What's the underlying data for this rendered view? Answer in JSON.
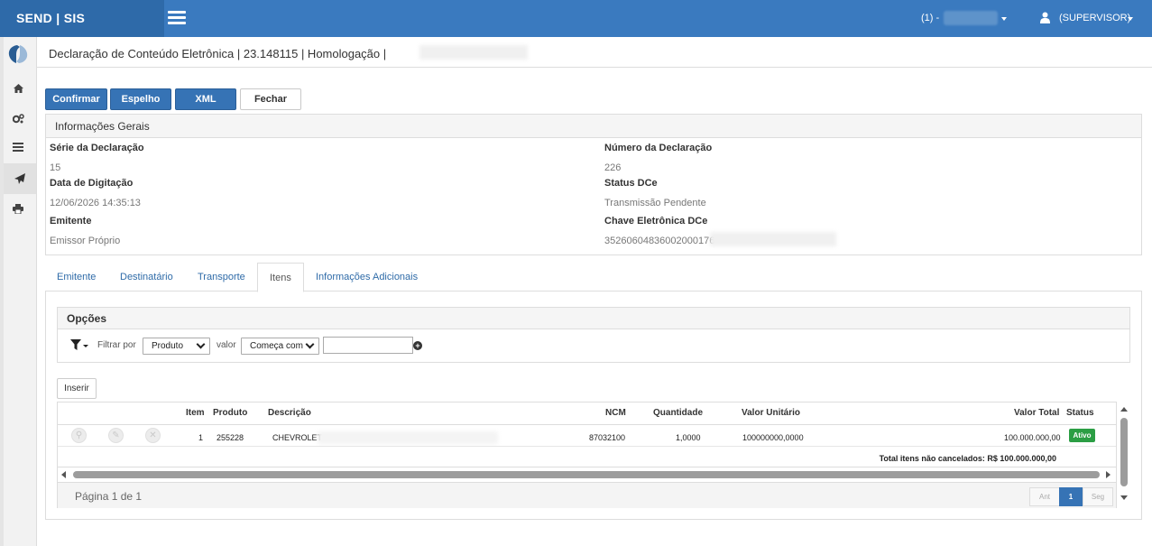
{
  "header": {
    "brand": "SEND | SIS",
    "company_label": "(1) -",
    "user_label": "(SUPERVISOR)"
  },
  "page": {
    "title": "Declaração de Conteúdo Eletrônica | 23.148115 | Homologação |"
  },
  "toolbar": {
    "confirm": "Confirmar",
    "mirror": "Espelho",
    "xml": "XML",
    "close": "Fechar"
  },
  "info": {
    "heading": "Informações Gerais",
    "serie_label": "Série da Declaração",
    "serie_value": "15",
    "numero_label": "Número da Declaração",
    "numero_value": "226",
    "data_label": "Data de Digitação",
    "data_value": "12/06/2026 14:35:13",
    "status_label": "Status DCe",
    "status_value": "Transmissão Pendente",
    "emitente_label": "Emitente",
    "emitente_value": "Emissor Próprio",
    "chave_label": "Chave Eletrônica DCe",
    "chave_value": "35260604836002000176"
  },
  "tabs": [
    {
      "label": "Emitente"
    },
    {
      "label": "Destinatário"
    },
    {
      "label": "Transporte"
    },
    {
      "label": "Itens"
    },
    {
      "label": "Informações Adicionais"
    }
  ],
  "options": {
    "heading": "Opções",
    "filter_by_label": "Filtrar por",
    "filter_by_value": "Produto",
    "value_label": "valor",
    "value_mode": "Começa com",
    "search_value": ""
  },
  "grid": {
    "insert_label": "Inserir",
    "columns": {
      "item": "Item",
      "produto": "Produto",
      "descricao": "Descrição",
      "ncm": "NCM",
      "quantidade": "Quantidade",
      "valor_unitario": "Valor Unitário",
      "valor_total": "Valor Total",
      "status": "Status"
    },
    "rows": [
      {
        "item": "1",
        "produto": "255228",
        "descricao": "CHEVROLET",
        "ncm": "87032100",
        "quantidade": "1,0000",
        "valor_unitario": "100000000,0000",
        "valor_total": "100.000.000,00",
        "status": "Ativo"
      }
    ],
    "total_label": "Total itens não cancelados: R$ 100.000.000,00",
    "page_info": "Página 1 de 1",
    "pager_prev": "Ant",
    "pager_current": "1",
    "pager_next": "Seg"
  },
  "colors": {
    "topbar": "#3a7abf",
    "brand_bg": "#2e6aa9",
    "primary_button": "#3673b5",
    "status_active": "#2b9e44",
    "link": "#2f6ba8"
  },
  "icons": {
    "menu": "hamburger-icon",
    "user": "user-icon",
    "home": "home-icon",
    "settings": "gears-icon",
    "list": "list-icon",
    "send": "paper-plane-icon",
    "print": "print-icon",
    "filter": "filter-icon",
    "add": "plus-circle-icon",
    "view": "search-icon",
    "edit": "pencil-icon",
    "delete": "times-icon"
  }
}
